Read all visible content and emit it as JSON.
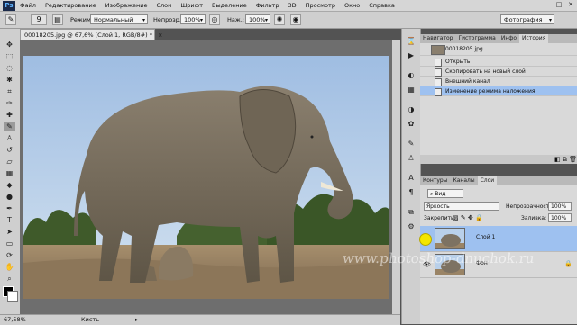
{
  "menubar": {
    "logo": "Ps",
    "items": [
      "Файл",
      "Редактирование",
      "Изображение",
      "Слои",
      "Шрифт",
      "Выделение",
      "Фильтр",
      "3D",
      "Просмотр",
      "Окно",
      "Справка"
    ],
    "window_controls": [
      "–",
      "□",
      "✕"
    ]
  },
  "options": {
    "brush_size": "9",
    "mode_label": "Режим:",
    "mode_value": "Нормальный",
    "opacity_label": "Непрозр.:",
    "opacity_value": "100%",
    "pressure_label": "Наж.:",
    "pressure_value": "100%",
    "workspace": "Фотография"
  },
  "document": {
    "tab_title": "00018205.jpg @ 67,6% (Слой 1, RGB/8#) *",
    "tab_close": "×",
    "zoom": "67,58%",
    "status_text": "Кисть"
  },
  "history_panel": {
    "tabs": [
      "Навигатор",
      "Гистограмма",
      "Инфо",
      "История"
    ],
    "active_tab": "История",
    "snapshot": "00018205.jpg",
    "items": [
      "Открыть",
      "Скопировать на новый слой",
      "Внешний канал",
      "Изменение режима наложения"
    ],
    "active_item": "Изменение режима наложения"
  },
  "layers_panel": {
    "tabs": [
      "Контуры",
      "Каналы",
      "Слои"
    ],
    "active_tab": "Слои",
    "filter_value": "Вид",
    "blend_mode": "Яркость",
    "opacity_label": "Непрозрачность:",
    "opacity_value": "100%",
    "lock_label": "Закрепить:",
    "fill_label": "Заливка:",
    "fill_value": "100%",
    "layers": [
      {
        "name": "Слой 1",
        "active": true
      },
      {
        "name": "Фон",
        "active": false
      }
    ]
  },
  "watermark": "www.photoshop-dnuchok.ru",
  "colors": {
    "sky": "#b9d0ea",
    "elephant": "#7d7262",
    "ground": "#9a8466",
    "trees": "#3f5a2a",
    "selection": "#9ec1f0",
    "cursor": "#f3e600"
  }
}
